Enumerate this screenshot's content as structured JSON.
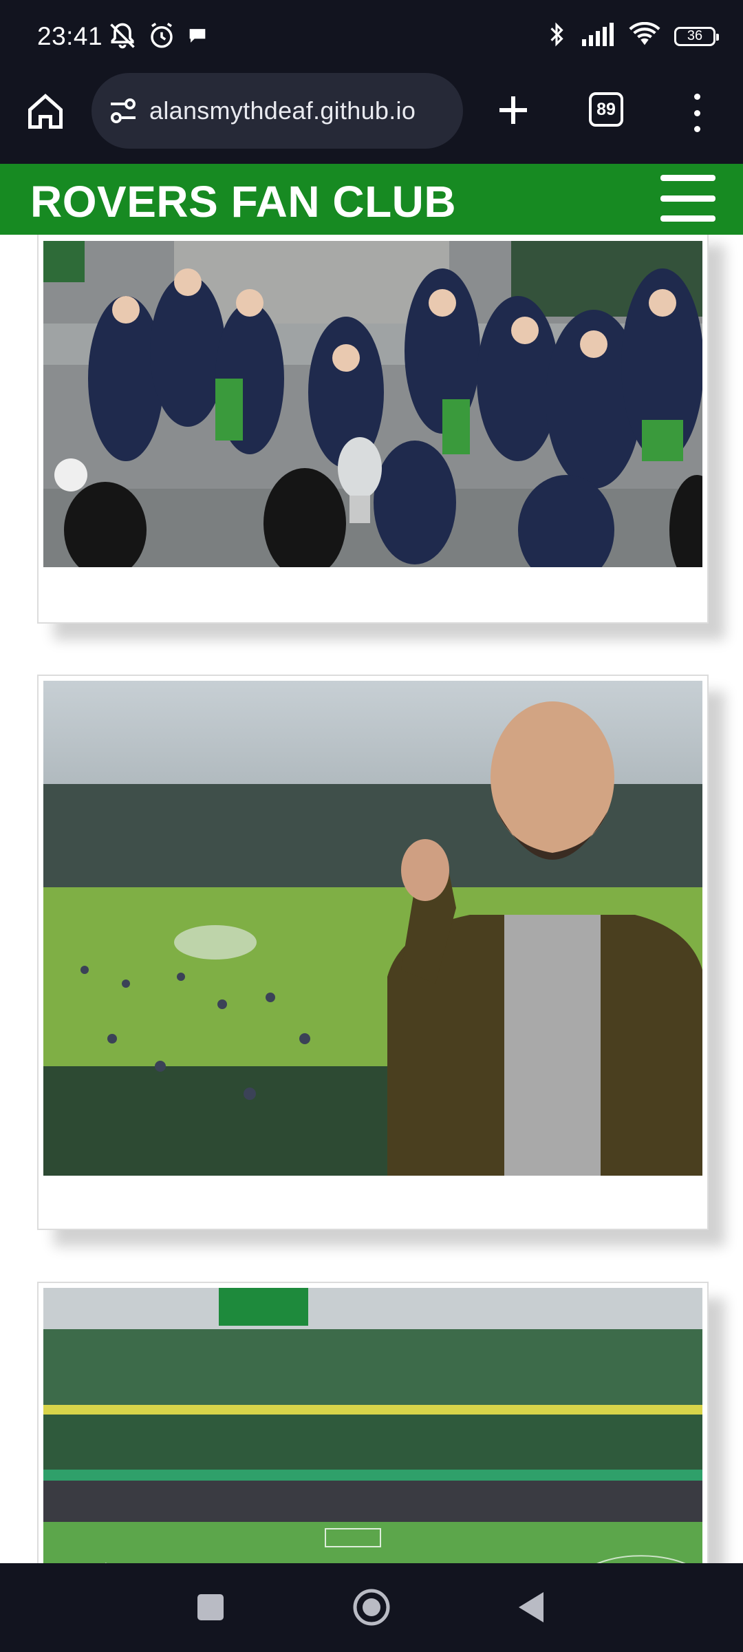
{
  "status_bar": {
    "time": "23:41",
    "battery": "36",
    "icons_left": [
      "notifications-off-icon",
      "alarm-icon",
      "chat-bubble-icon"
    ],
    "icons_right": [
      "bluetooth-icon",
      "signal-icon",
      "wifi-icon",
      "battery-icon"
    ]
  },
  "browser": {
    "url": "alansmythdeaf.github.io",
    "tab_count": "89",
    "icons": [
      "home-icon",
      "site-settings-icon",
      "new-tab-icon",
      "tab-switcher-icon",
      "overflow-menu-icon"
    ]
  },
  "site": {
    "title": "ROVERS FAN CLUB",
    "menu_icon": "hamburger-icon",
    "brand_color": "#178a22"
  },
  "gallery": {
    "photos": [
      {
        "icon": "team-trophy-photo"
      },
      {
        "icon": "fan-selfie-stadium-photo"
      },
      {
        "icon": "stadium-crowd-photo"
      }
    ]
  },
  "nav": {
    "icons": [
      "recents-icon",
      "home-icon",
      "back-icon"
    ]
  }
}
